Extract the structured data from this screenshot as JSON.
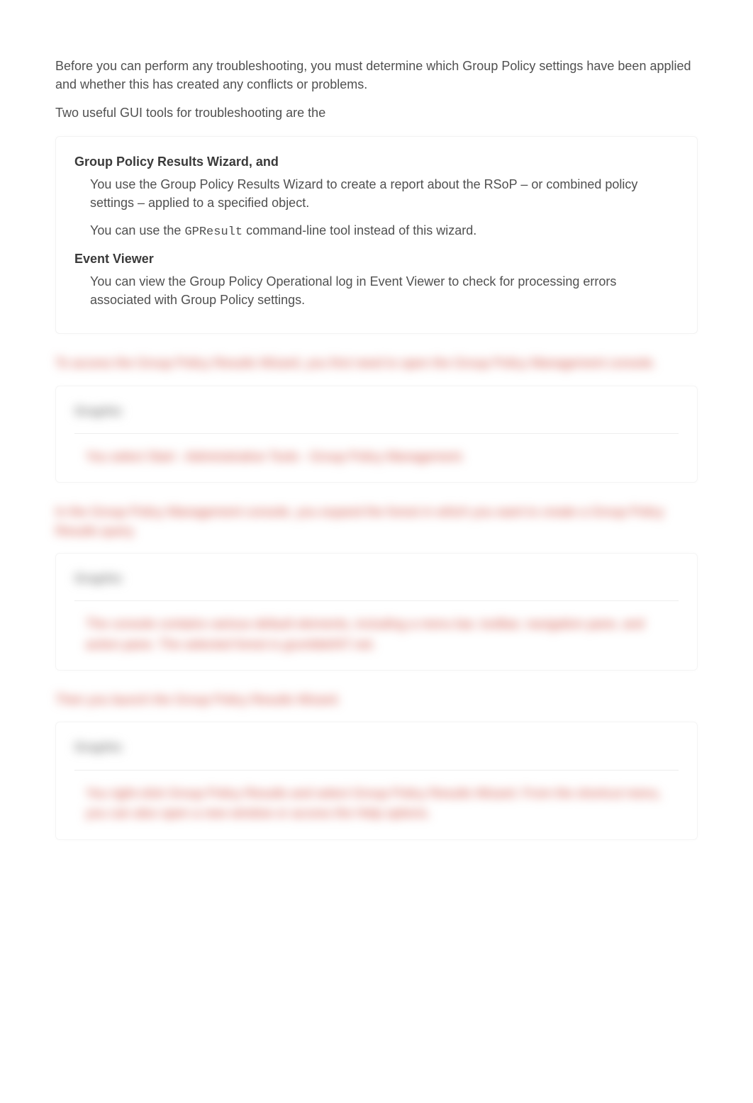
{
  "intro": {
    "p1": "Before you can perform any troubleshooting, you must determine which Group Policy settings have been applied and whether this has created any conflicts or problems.",
    "p2": "Two useful GUI tools for troubleshooting are the"
  },
  "tools": {
    "item1": {
      "term": "Group Policy Results Wizard, and",
      "def_p1_a": "You use the Group Policy Results Wizard to create a report about the RSoP – or combined policy settings – applied to a specified object.",
      "def_p2_a": "You can use the ",
      "def_p2_code": "GPResult",
      "def_p2_b": " command-line tool instead of this wizard."
    },
    "item2": {
      "term": "Event Viewer",
      "def_p1": "You can view the Group Policy Operational log in Event Viewer to check for processing errors associated with Group Policy settings."
    }
  },
  "blurred": {
    "para1": "To access the Group Policy Results Wizard, you first need to open the Group Policy Management console.",
    "card1": {
      "title": "Graphic",
      "body": "You select Start - Administrative Tools - Group Policy Management."
    },
    "para2": "In the Group Policy Management console, you expand the forest in which you want to create a Group Policy Results query.",
    "card2": {
      "title": "Graphic",
      "body": "The console contains various default elements, including a menu bar, toolbar, navigation pane, and action pane.  The selected forest is grumble047.net."
    },
    "para3": "Then you launch the Group Policy Results Wizard.",
    "card3": {
      "title": "Graphic",
      "body": "You right-click Group Policy Results and select Group Policy Results Wizard.  From the shortcut menu, you can also open a new window or access the Help options."
    }
  }
}
